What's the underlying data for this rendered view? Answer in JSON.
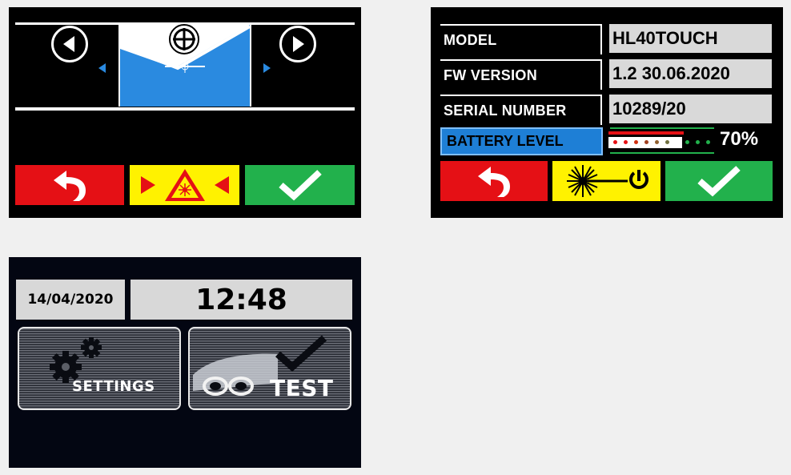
{
  "alignment_screen": {
    "back_icon": "undo-arrow-icon",
    "laser_icon": "laser-warning-icon",
    "confirm_icon": "checkmark-icon",
    "colors": {
      "red": "#e51015",
      "yellow": "#fff200",
      "green": "#22b14c",
      "blue": "#2a8ae0"
    }
  },
  "info_screen": {
    "rows": [
      {
        "label": "MODEL",
        "value": "HL40TOUCH"
      },
      {
        "label": "FW VERSION",
        "value": "1.2 30.06.2020"
      },
      {
        "label": "SERIAL NUMBER",
        "value": "10289/20"
      }
    ],
    "battery": {
      "label": "BATTERY LEVEL",
      "percent_text": "70%",
      "level": 0.7
    },
    "back_icon": "undo-arrow-icon",
    "laser_power_icon": "laser-power-icon",
    "confirm_icon": "checkmark-icon"
  },
  "home_screen": {
    "date": "14/04/2020",
    "time": "12:48",
    "settings_label": "SETTINGS",
    "test_label": "TEST"
  }
}
